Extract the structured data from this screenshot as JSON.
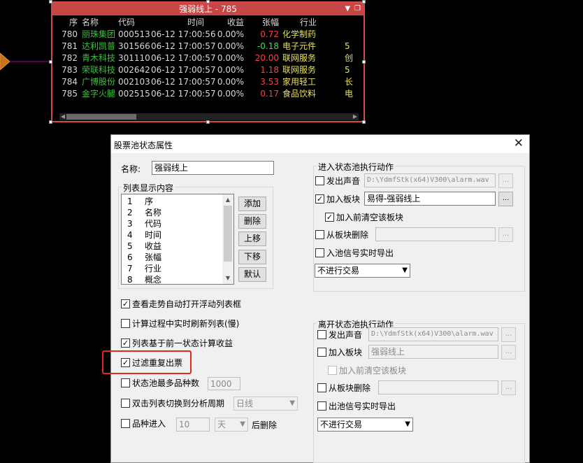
{
  "float_panel": {
    "title": "强弱线上 - 785",
    "headers": {
      "seq": "序",
      "name": "名称",
      "code": "代码",
      "time": "时间",
      "ret": "收益",
      "chg": "张幅",
      "ind": "行业"
    },
    "rows": [
      {
        "seq": "780",
        "name": "丽珠集团",
        "code": "000513",
        "time": "06-12 17:00:56",
        "ret": "0.00%",
        "chg": "0.72",
        "ind": "化学制药",
        "con": ""
      },
      {
        "seq": "781",
        "name": "达利凯普",
        "code": "301566",
        "time": "06-12 17:00:57",
        "ret": "0.00%",
        "chg": "-0.18",
        "ind": "电子元件",
        "con": "5"
      },
      {
        "seq": "782",
        "name": "青木科技",
        "code": "301110",
        "time": "06-12 17:00:57",
        "ret": "0.00%",
        "chg": "20.00",
        "ind": "联网服务",
        "con": "创"
      },
      {
        "seq": "783",
        "name": "荣联科技",
        "code": "002642",
        "time": "06-12 17:00:57",
        "ret": "0.00%",
        "chg": "1.18",
        "ind": "联网服务",
        "con": "5"
      },
      {
        "seq": "784",
        "name": "广博股份",
        "code": "002103",
        "time": "06-12 17:00:57",
        "ret": "0.00%",
        "chg": "3.53",
        "ind": "家用轻工",
        "con": "长"
      },
      {
        "seq": "785",
        "name": "金字火腿",
        "code": "002515",
        "time": "06-12 17:00:57",
        "ret": "0.00%",
        "chg": "0.17",
        "ind": "食品饮料",
        "con": "电"
      }
    ]
  },
  "dialog": {
    "title": "股票池状态属性",
    "name_label": "名称:",
    "name_value": "强弱线上",
    "list_group_title": "列表显示内容",
    "list_items": [
      {
        "n": "1",
        "label": "序"
      },
      {
        "n": "2",
        "label": "名称"
      },
      {
        "n": "3",
        "label": "代码"
      },
      {
        "n": "4",
        "label": "时间"
      },
      {
        "n": "5",
        "label": "收益"
      },
      {
        "n": "6",
        "label": "张幅"
      },
      {
        "n": "7",
        "label": "行业"
      },
      {
        "n": "8",
        "label": "概念"
      }
    ],
    "buttons": {
      "add": "添加",
      "delete": "删除",
      "up": "上移",
      "down": "下移",
      "default": "默认"
    },
    "options": {
      "auto_open_float": "查看走势自动打开浮动列表框",
      "realtime_refresh": "计算过程中实时刷新列表(慢)",
      "based_on_prev": "列表基于前一状态计算收益",
      "filter_dup": "过滤重复出票",
      "max_count": "状态池最多品种数",
      "max_count_value": "1000",
      "dblclick_switch": "双击列表切换到分析周期",
      "dblclick_period": "日线",
      "stock_enter": "品种进入",
      "enter_days": "10",
      "enter_unit": "天",
      "enter_after": "后删除"
    },
    "enter_group": {
      "title": "进入状态池执行动作",
      "sound_label": "发出声音",
      "sound_path": "D:\\YdmfStk(x64)V300\\alarm.wav",
      "add_block_label": "加入板块",
      "add_block_value": "易得-强弱线上",
      "clear_before_label": "加入前清空该板块",
      "remove_block_label": "从板块删除",
      "export_label": "入池信号实时导出",
      "trade_select": "不进行交易"
    },
    "leave_group": {
      "title": "离开状态池执行动作",
      "sound_label": "发出声音",
      "sound_path": "D:\\YdmfStk(x64)V300\\alarm.wav",
      "add_block_label": "加入板块",
      "add_block_value": "强弱线上",
      "clear_before_label": "加入前清空该板块",
      "remove_block_label": "从板块删除",
      "export_label": "出池信号实时导出",
      "trade_select": "不进行交易"
    },
    "dots": "..."
  },
  "colors": {
    "panel_border": "#d24b4b",
    "titlebar": "#c94646",
    "stock_name": "#3fbf3f",
    "up": "#ff4040",
    "down": "#3fdf3f",
    "highlight": "#e8261f"
  }
}
